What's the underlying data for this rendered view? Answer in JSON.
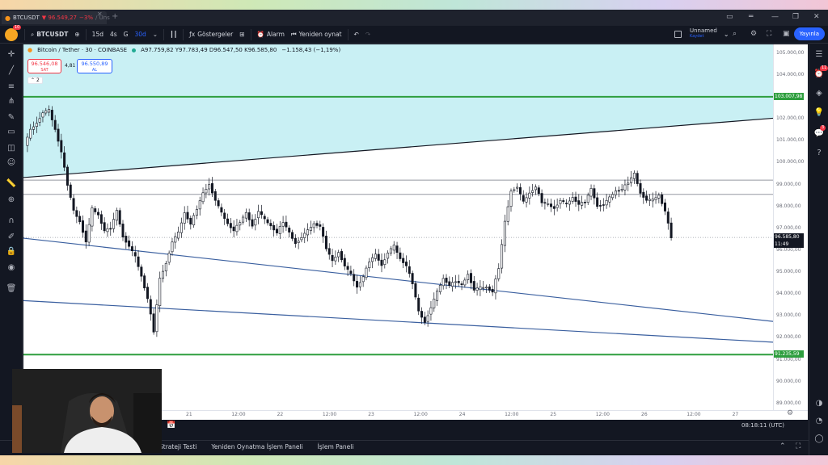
{
  "window": {
    "tab_symbol": "BTCUSDT",
    "tab_price": "▼ 96.549,27",
    "tab_change": "−3%",
    "tab_suffix": "/ Uns"
  },
  "toolbar": {
    "symbol": "BTCUSDT",
    "intervals": [
      "15d",
      "4s",
      "G",
      "30d"
    ],
    "active_interval": "30d",
    "indicators_label": "Göstergeler",
    "alarm_label": "Alarm",
    "replay_label": "Yeniden oynat",
    "layout_name": "Unnamed",
    "layout_status": "Kaydet",
    "publish_label": "Yayınla",
    "avatar_badge": "10"
  },
  "legend": {
    "title": "Bitcoin / Tether · 30 · COINBASE",
    "ohlc": "A97.759,82 Y97.783,49 D96.547,50 K96.585,80",
    "change": "−1.158,43 (−1,19%)",
    "sell_price": "96.546,08",
    "sell_label": "SAT",
    "buy_price": "96.550,89",
    "buy_label": "AL",
    "spread": "4,81",
    "collapsed_count": "2"
  },
  "price_axis": {
    "ticks": [
      "105.000,00",
      "104.000,00",
      "103.000,00",
      "102.000,00",
      "101.000,00",
      "100.000,00",
      "99.000,00",
      "98.000,00",
      "97.000,00",
      "96.000,00",
      "95.000,00",
      "94.000,00",
      "93.000,00",
      "92.000,00",
      "91.000,00",
      "90.000,00",
      "89.000,00"
    ],
    "label_upper": "103.007,98",
    "label_lower": "91.235,59",
    "label_current": "96.585,80",
    "label_countdown": "11:49"
  },
  "time_axis": {
    "ticks": [
      "21",
      "12:00",
      "22",
      "12:00",
      "23",
      "12:00",
      "24",
      "12:00",
      "25",
      "12:00",
      "26",
      "12:00",
      "27"
    ]
  },
  "bottom": {
    "clock": "08:18:11 (UTC)",
    "panels": [
      "Strateji Testi",
      "Yeniden Oynatma İşlem Paneli",
      "İşlem Paneli"
    ]
  },
  "badges": {
    "alerts": "11",
    "notifications": "3"
  },
  "chart_data": {
    "type": "candlestick",
    "title": "Bitcoin / Tether · 30 · COINBASE",
    "ylim": [
      88700,
      105400
    ],
    "x": [
      "21",
      "12:00",
      "22",
      "12:00",
      "23",
      "12:00",
      "24",
      "12:00",
      "25",
      "12:00",
      "26",
      "12:00",
      "27"
    ],
    "close_trace": [
      100800,
      101500,
      101800,
      102300,
      102400,
      101500,
      100500,
      99000,
      97800,
      97300,
      96400,
      97900,
      97600,
      96900,
      97000,
      97800,
      96600,
      96200,
      95700,
      94800,
      93800,
      92300,
      94700,
      95400,
      96400,
      96800,
      97700,
      97200,
      97900,
      98600,
      99000,
      98300,
      97700,
      97200,
      96900,
      97300,
      97700,
      97100,
      97800,
      97400,
      97100,
      96800,
      97300,
      96800,
      96300,
      96600,
      96900,
      97200,
      97100,
      96100,
      95500,
      95900,
      95300,
      94900,
      94300,
      94800,
      95500,
      95800,
      95300,
      95900,
      96200,
      95600,
      95300,
      94500,
      93200,
      92700,
      93400,
      94100,
      94700,
      94400,
      94600,
      94400,
      94900,
      94200,
      94300,
      94300,
      94100,
      95200,
      97300,
      98700,
      98900,
      98200,
      98600,
      98900,
      98200,
      98100,
      97900,
      98300,
      98100,
      98400,
      98100,
      98200,
      98800,
      98000,
      98100,
      98400,
      98700,
      98800,
      99100,
      99500,
      98600,
      98300,
      98300,
      98500,
      97800,
      96600
    ],
    "horizontal_levels": [
      103007.98,
      99200,
      98550,
      91235.59
    ],
    "current_price": 96585.8
  }
}
